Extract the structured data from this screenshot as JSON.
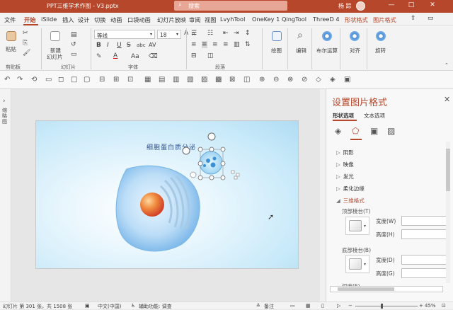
{
  "titlebar": {
    "doc_title": "PPT三维学术作图 - V3.pptx",
    "search_icon": "search-icon",
    "search_placeholder": "搜索",
    "user": "杨 踪",
    "minimize": "—",
    "maximize": "□",
    "close": "✕",
    "accent": "#b7472a"
  },
  "tabs": [
    "文件",
    "开始",
    "iSlide",
    "插入",
    "设计",
    "切换",
    "动画",
    "口袋动画",
    "幻灯片放映",
    "审阅",
    "视图",
    "LvyhTool",
    "OneKey 1",
    "QingTool",
    "ThreeD 4",
    "形状格式",
    "图片格式"
  ],
  "ribbon": {
    "paste": "粘贴",
    "new_slide_line1": "新建",
    "new_slide_line2": "幻灯片",
    "font_name": "等线",
    "font_size": "18",
    "bold": "B",
    "italic": "I",
    "underline": "U",
    "strike": "S",
    "shadow": "abc",
    "spacing": "AV",
    "font_color": "A",
    "grow": "A",
    "shrink": "A",
    "draw": "绘图",
    "edit": "编辑",
    "boolean": "布尔运算",
    "align": "对齐",
    "rotate": "旋转",
    "group_clipboard": "剪贴板",
    "group_slides": "幻灯片",
    "group_font": "字体",
    "group_paragraph": "段落"
  },
  "quickaccess": [
    "↶",
    "↷",
    "⟲",
    "▭",
    "◻",
    "□",
    "▢",
    "⊟",
    "⊞",
    "⊡",
    "▦",
    "▤",
    "▥",
    "▧",
    "▨",
    "▩",
    "⊠",
    "◫",
    "⊕",
    "⊖",
    "⊗",
    "⊘",
    "◇",
    "◈",
    "▣"
  ],
  "sidebar": {
    "arrow": "›",
    "label": "缩略图"
  },
  "slide": {
    "title": "细胞蛋白质分泌"
  },
  "panel": {
    "title": "设置图片格式",
    "close": "✕",
    "tab_shape": "形状选项",
    "tab_text": "文本选项",
    "icons": [
      "fill-icon",
      "effects-icon",
      "layout-icon",
      "picture-icon"
    ],
    "sections": [
      {
        "label": "阴影",
        "open": false
      },
      {
        "label": "映像",
        "open": false
      },
      {
        "label": "发光",
        "open": false
      },
      {
        "label": "柔化边缘",
        "open": false
      },
      {
        "label": "三维格式",
        "open": true
      }
    ],
    "top_bevel": "顶部棱台(T)",
    "bottom_bevel": "底部棱台(B)",
    "width_top": "宽度(W)",
    "height_top": "高度(H)",
    "width_bottom": "宽度(D)",
    "height_bottom": "高度(G)",
    "depth": "深度(E)"
  },
  "status": {
    "slide_info": "幻灯片 第 301 张，共 1508 张",
    "lang": "中文(中国)",
    "accessibility": "辅助功能: 调查",
    "notes": "备注",
    "zoom": "45%"
  }
}
